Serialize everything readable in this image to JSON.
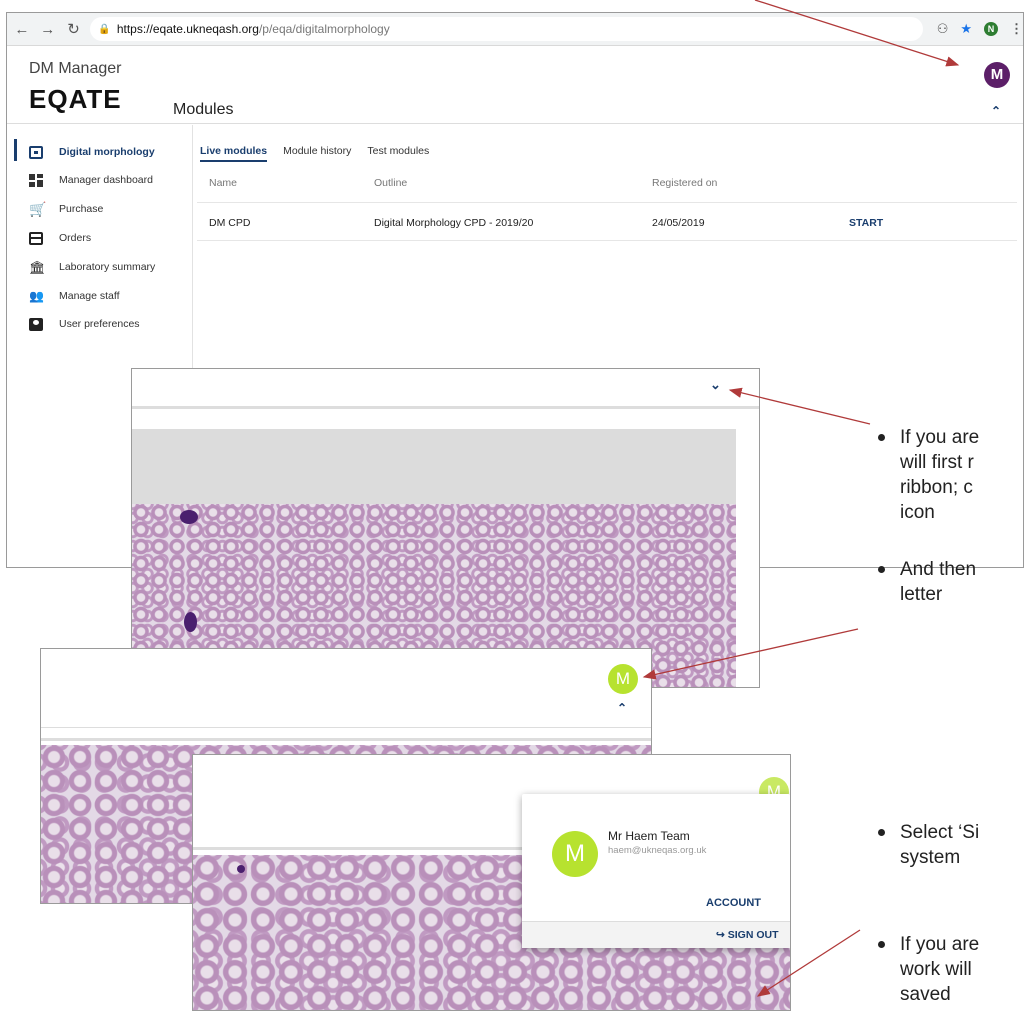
{
  "browser": {
    "url_host": "https://eqate.ukneqash.org",
    "url_path": "/p/eqa/digitalmorphology",
    "extension_letter": "N"
  },
  "app": {
    "subtitle": "DM Manager",
    "logo": "EQATE",
    "page_title": "Modules",
    "avatar_letter": "M"
  },
  "sidebar": {
    "items": [
      {
        "label": "Digital morphology",
        "icon": "calendar-icon"
      },
      {
        "label": "Manager dashboard",
        "icon": "dashboard-icon"
      },
      {
        "label": "Purchase",
        "icon": "cart-icon"
      },
      {
        "label": "Orders",
        "icon": "credit-card-icon"
      },
      {
        "label": "Laboratory summary",
        "icon": "bank-icon"
      },
      {
        "label": "Manage staff",
        "icon": "people-icon"
      },
      {
        "label": "User preferences",
        "icon": "account-box-icon"
      }
    ]
  },
  "tabs": [
    "Live modules",
    "Module history",
    "Test modules"
  ],
  "table": {
    "headers": [
      "Name",
      "Outline",
      "Registered on",
      ""
    ],
    "rows": [
      {
        "name": "DM CPD",
        "outline": "Digital Morphology CPD - 2019/20",
        "registered": "24/05/2019",
        "action": "START"
      }
    ]
  },
  "profile": {
    "avatar_letter": "M",
    "name": "Mr Haem Team",
    "email": "haem@ukneqas.org.uk",
    "account_label": "ACCOUNT",
    "signout_label": "SIGN OUT"
  },
  "instructions": [
    "If you are",
    "will first r",
    "ribbon; c",
    "icon",
    "And then",
    "letter",
    "Select ‘Si",
    "system",
    "If you are",
    "work will",
    "saved"
  ],
  "colors": {
    "accent": "#1a3e6e",
    "avatar_purple": "#5c1f68",
    "avatar_green": "#b7e22f",
    "arrow": "#b03a3a"
  }
}
